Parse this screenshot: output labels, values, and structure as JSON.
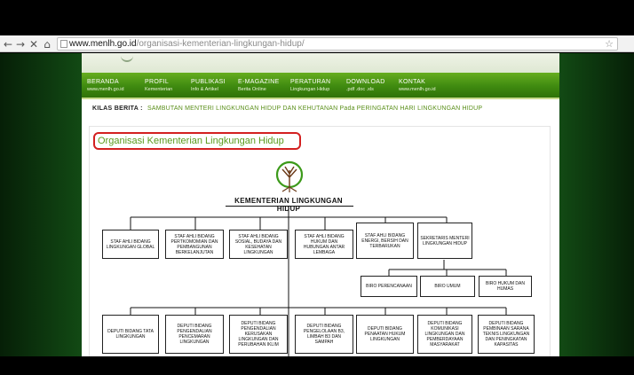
{
  "browser": {
    "url_host": "www.menlh.go.id",
    "url_path": "/organisasi-kementerian-lingkungan-hidup/",
    "back_glyph": "←",
    "forward_glyph": "→",
    "stop_glyph": "✕",
    "home_glyph": "⌂",
    "star_glyph": "☆"
  },
  "menu": [
    {
      "title": "BERANDA",
      "sub": "www.menlh.go.id"
    },
    {
      "title": "PROFIL",
      "sub": "Kementerian"
    },
    {
      "title": "PUBLIKASI",
      "sub": "Info & Artikel"
    },
    {
      "title": "E-MAGAZINE",
      "sub": "Berita Online"
    },
    {
      "title": "PERATURAN",
      "sub": "Lingkungan Hidup"
    },
    {
      "title": "DOWNLOAD",
      "sub": ".pdf .doc .xls"
    },
    {
      "title": "KONTAK",
      "sub": "www.menlh.go.id"
    }
  ],
  "kilas": {
    "label": "KILAS BERITA :",
    "text": "SAMBUTAN MENTERI LINGKUNGAN HIDUP DAN KEHUTANAN Pada PERINGATAN HARI LINGKUNGAN HIDUP"
  },
  "page_title": "Organisasi Kementerian Lingkungan Hidup",
  "org": {
    "title": "KEMENTERIAN LINGKUNGAN HIDUP",
    "staf": [
      "STAF AHLI BIDANG LINGKUNGAN GLOBAL",
      "STAF AHLI BIDANG PERTKOMOMIAN DAN PEMBANGUNAN BERKELANJUTAN",
      "STAF AHLI BIDANG SOSIAL, BUDAYA DAN KESEHATAN LINGKUNGAN",
      "STAF AHLI BIDANG HUKUM DAN HUBUNGAN ANTAR LEMBAGA",
      "STAF AHLI BIDANG ENERGI, BERSIH DAN TERBARUKAN",
      "SEKRETARIS MENTERI LINGKUNGAN HIDUP"
    ],
    "biro": [
      "BIRO PERENCANAAN",
      "BIRO UMUM",
      "BIRO HUKUM DAN HUMAS"
    ],
    "deputi": [
      "DEPUTI BIDANG TATA LINGKUNGAN",
      "DEPUTI BIDANG PENGENDALIAN PENCEMARAN LINGKUNGAN",
      "DEPUTI BIDANG PENGENDALIAN KERUSAKAN LINGKUNGAN DAN PERUBAHAN IKLIM",
      "DEPUTI BIDANG PENGELOLAAN B3, LIMBAH B3 DAN SAMPAH",
      "DEPUTI BIDANG PENAATAN HUKUM LINGKUNGAN",
      "DEPUTI BIDANG KOMUNIKASI LINGKUNGAN DAN PEMBERDAYAAN MASYARAKAT",
      "DEPUTI BIDANG PEMBINAAN SARANA TEKNIS LINGKUNGAN DAN PENINGKATAN KAPASITAS"
    ]
  },
  "colors": {
    "menu_green": "#3f8a10",
    "title_green": "#5a9a1c",
    "highlight_red": "#d32020",
    "background_green": "#0d3d0f"
  }
}
